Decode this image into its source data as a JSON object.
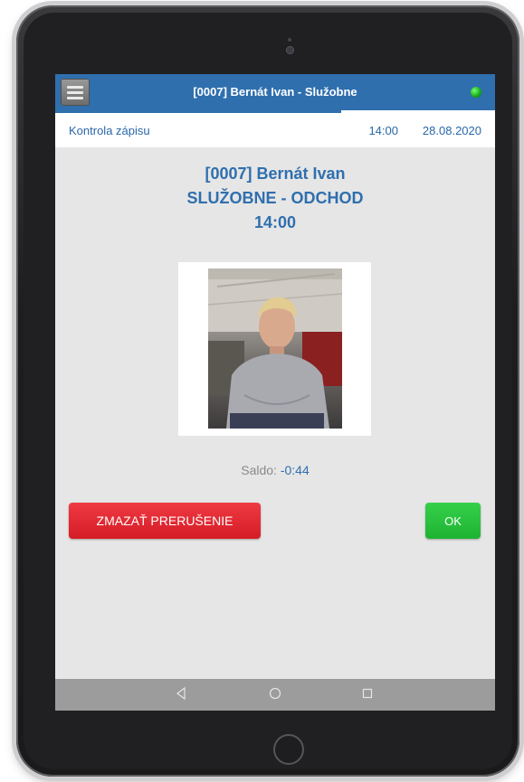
{
  "titlebar": {
    "title": "[0007] Bernát Ivan - Služobne",
    "menu_icon": "hamburger-menu-icon",
    "status_color": "#18a818"
  },
  "progress": {
    "value_percent": 65
  },
  "subbar": {
    "label": "Kontrola zápisu",
    "time": "14:00",
    "date": "28.08.2020"
  },
  "main": {
    "name": "[0007] Bernát Ivan",
    "action": "SLUŽOBNE - ODCHOD",
    "time": "14:00",
    "saldo_label": "Saldo:",
    "saldo_value": "-0:44"
  },
  "buttons": {
    "delete_label": "ZMAZAŤ PRERUŠENIE",
    "ok_label": "OK"
  },
  "colors": {
    "accent": "#2f6fae",
    "danger": "#d51c26",
    "success": "#1eb332"
  },
  "navbar": {
    "back_icon": "back-triangle-icon",
    "home_icon": "home-circle-icon",
    "recents_icon": "recents-square-icon"
  }
}
